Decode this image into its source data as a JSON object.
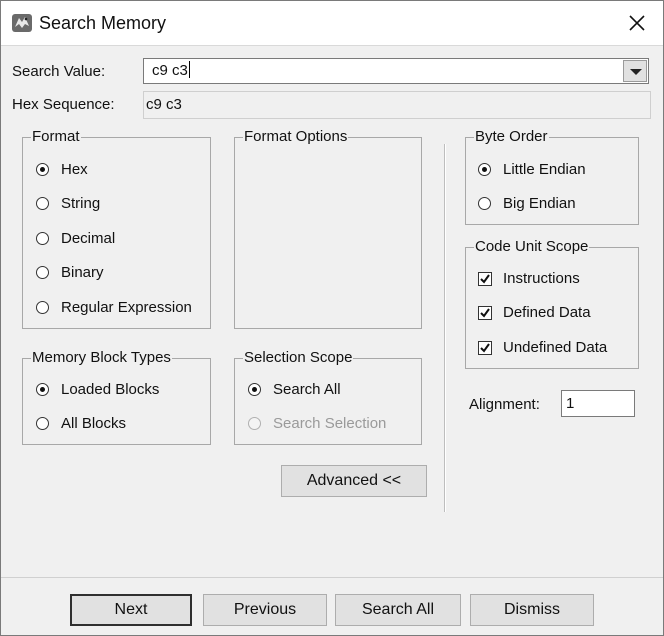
{
  "window": {
    "title": "Search Memory",
    "icon": "dragon-app-icon",
    "close_icon": "close-icon"
  },
  "search": {
    "value_label": "Search Value:",
    "value": "c9 c3",
    "hex_label": "Hex Sequence:",
    "hex_value": "c9 c3"
  },
  "format": {
    "title": "Format",
    "options": [
      {
        "label": "Hex",
        "selected": true
      },
      {
        "label": "String",
        "selected": false
      },
      {
        "label": "Decimal",
        "selected": false
      },
      {
        "label": "Binary",
        "selected": false
      },
      {
        "label": "Regular Expression",
        "selected": false
      }
    ]
  },
  "format_options": {
    "title": "Format Options"
  },
  "memory_block_types": {
    "title": "Memory Block Types",
    "options": [
      {
        "label": "Loaded Blocks",
        "selected": true
      },
      {
        "label": "All Blocks",
        "selected": false
      }
    ]
  },
  "selection_scope": {
    "title": "Selection Scope",
    "options": [
      {
        "label": "Search All",
        "selected": true,
        "enabled": true
      },
      {
        "label": "Search Selection",
        "selected": false,
        "enabled": false
      }
    ]
  },
  "byte_order": {
    "title": "Byte Order",
    "options": [
      {
        "label": "Little Endian",
        "selected": true
      },
      {
        "label": "Big Endian",
        "selected": false
      }
    ]
  },
  "code_unit_scope": {
    "title": "Code Unit Scope",
    "options": [
      {
        "label": "Instructions",
        "checked": true
      },
      {
        "label": "Defined Data",
        "checked": true
      },
      {
        "label": "Undefined Data",
        "checked": true
      }
    ]
  },
  "alignment": {
    "label": "Alignment:",
    "value": "1"
  },
  "advanced_button": "Advanced <<",
  "buttons": {
    "next": "Next",
    "previous": "Previous",
    "search_all": "Search All",
    "dismiss": "Dismiss"
  }
}
